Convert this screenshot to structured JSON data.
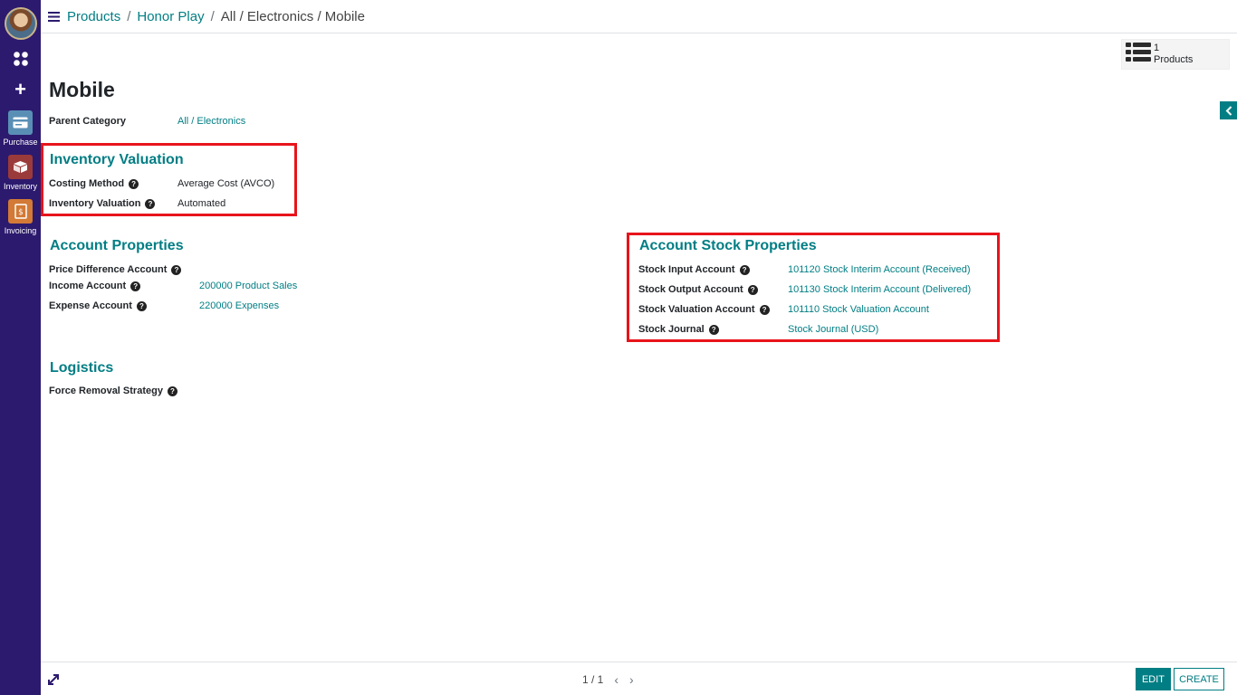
{
  "sidebar": {
    "apps": [
      {
        "label": "Purchase",
        "icon": "purchase-card-icon"
      },
      {
        "label": "Inventory",
        "icon": "inventory-box-icon"
      },
      {
        "label": "Invoicing",
        "icon": "invoice-dollar-icon"
      }
    ]
  },
  "breadcrumb": {
    "items": [
      "Products",
      "Honor Play"
    ],
    "current": "All / Electronics / Mobile",
    "separator": "/"
  },
  "smart_button": {
    "count": "1",
    "label": "Products"
  },
  "form": {
    "title": "Mobile",
    "parent_category": {
      "label": "Parent Category",
      "value": "All / Electronics"
    },
    "inventory_valuation": {
      "title": "Inventory Valuation",
      "fields": [
        {
          "label": "Costing Method",
          "value": "Average Cost (AVCO)"
        },
        {
          "label": "Inventory Valuation",
          "value": "Automated"
        }
      ]
    },
    "account_properties": {
      "title": "Account Properties",
      "fields": [
        {
          "label": "Price Difference Account",
          "value": ""
        },
        {
          "label": "Income Account",
          "value": "200000 Product Sales"
        },
        {
          "label": "Expense Account",
          "value": "220000 Expenses"
        }
      ]
    },
    "account_stock_properties": {
      "title": "Account Stock Properties",
      "fields": [
        {
          "label": "Stock Input Account",
          "value": "101120 Stock Interim Account (Received)"
        },
        {
          "label": "Stock Output Account",
          "value": "101130 Stock Interim Account (Delivered)"
        },
        {
          "label": "Stock Valuation Account",
          "value": "101110 Stock Valuation Account"
        },
        {
          "label": "Stock Journal",
          "value": "Stock Journal (USD)"
        }
      ]
    },
    "logistics": {
      "title": "Logistics",
      "fields": [
        {
          "label": "Force Removal Strategy",
          "value": ""
        }
      ]
    }
  },
  "pager": {
    "value": "1 / 1"
  },
  "buttons": {
    "edit": "EDIT",
    "create": "CREATE"
  },
  "colors": {
    "accent": "#017e84",
    "sidebar": "#2c1a6e",
    "highlight": "#e8141b"
  }
}
